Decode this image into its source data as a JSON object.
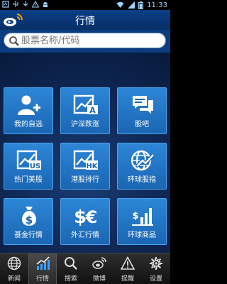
{
  "status_bar": {
    "time": "11:33"
  },
  "header": {
    "title": "行情"
  },
  "search": {
    "placeholder": "股票名称/代码"
  },
  "tiles": [
    {
      "label": "我的自选",
      "icon": "user-add-icon"
    },
    {
      "label": "沪深跌涨",
      "icon": "chart-a-icon"
    },
    {
      "label": "股吧",
      "icon": "chat-icon"
    },
    {
      "label": "热门美股",
      "icon": "chart-us-icon"
    },
    {
      "label": "港股排行",
      "icon": "chart-hk-icon"
    },
    {
      "label": "环球股指",
      "icon": "globe-chart-icon"
    },
    {
      "label": "基金行情",
      "icon": "money-bag-icon"
    },
    {
      "label": "外汇行情",
      "icon": "currency-icon"
    },
    {
      "label": "环球商品",
      "icon": "bar-chart-icon"
    }
  ],
  "tabs": [
    {
      "label": "新闻",
      "icon": "globe-icon",
      "active": false
    },
    {
      "label": "行情",
      "icon": "trend-icon",
      "active": true
    },
    {
      "label": "搜索",
      "icon": "search-icon",
      "active": false
    },
    {
      "label": "微博",
      "icon": "weibo-icon",
      "active": false
    },
    {
      "label": "提醒",
      "icon": "alert-icon",
      "active": false
    },
    {
      "label": "设置",
      "icon": "gear-icon",
      "active": false
    }
  ],
  "colors": {
    "tile": "#2479c9",
    "header": "#0b3f86",
    "background": "#0d2550"
  }
}
